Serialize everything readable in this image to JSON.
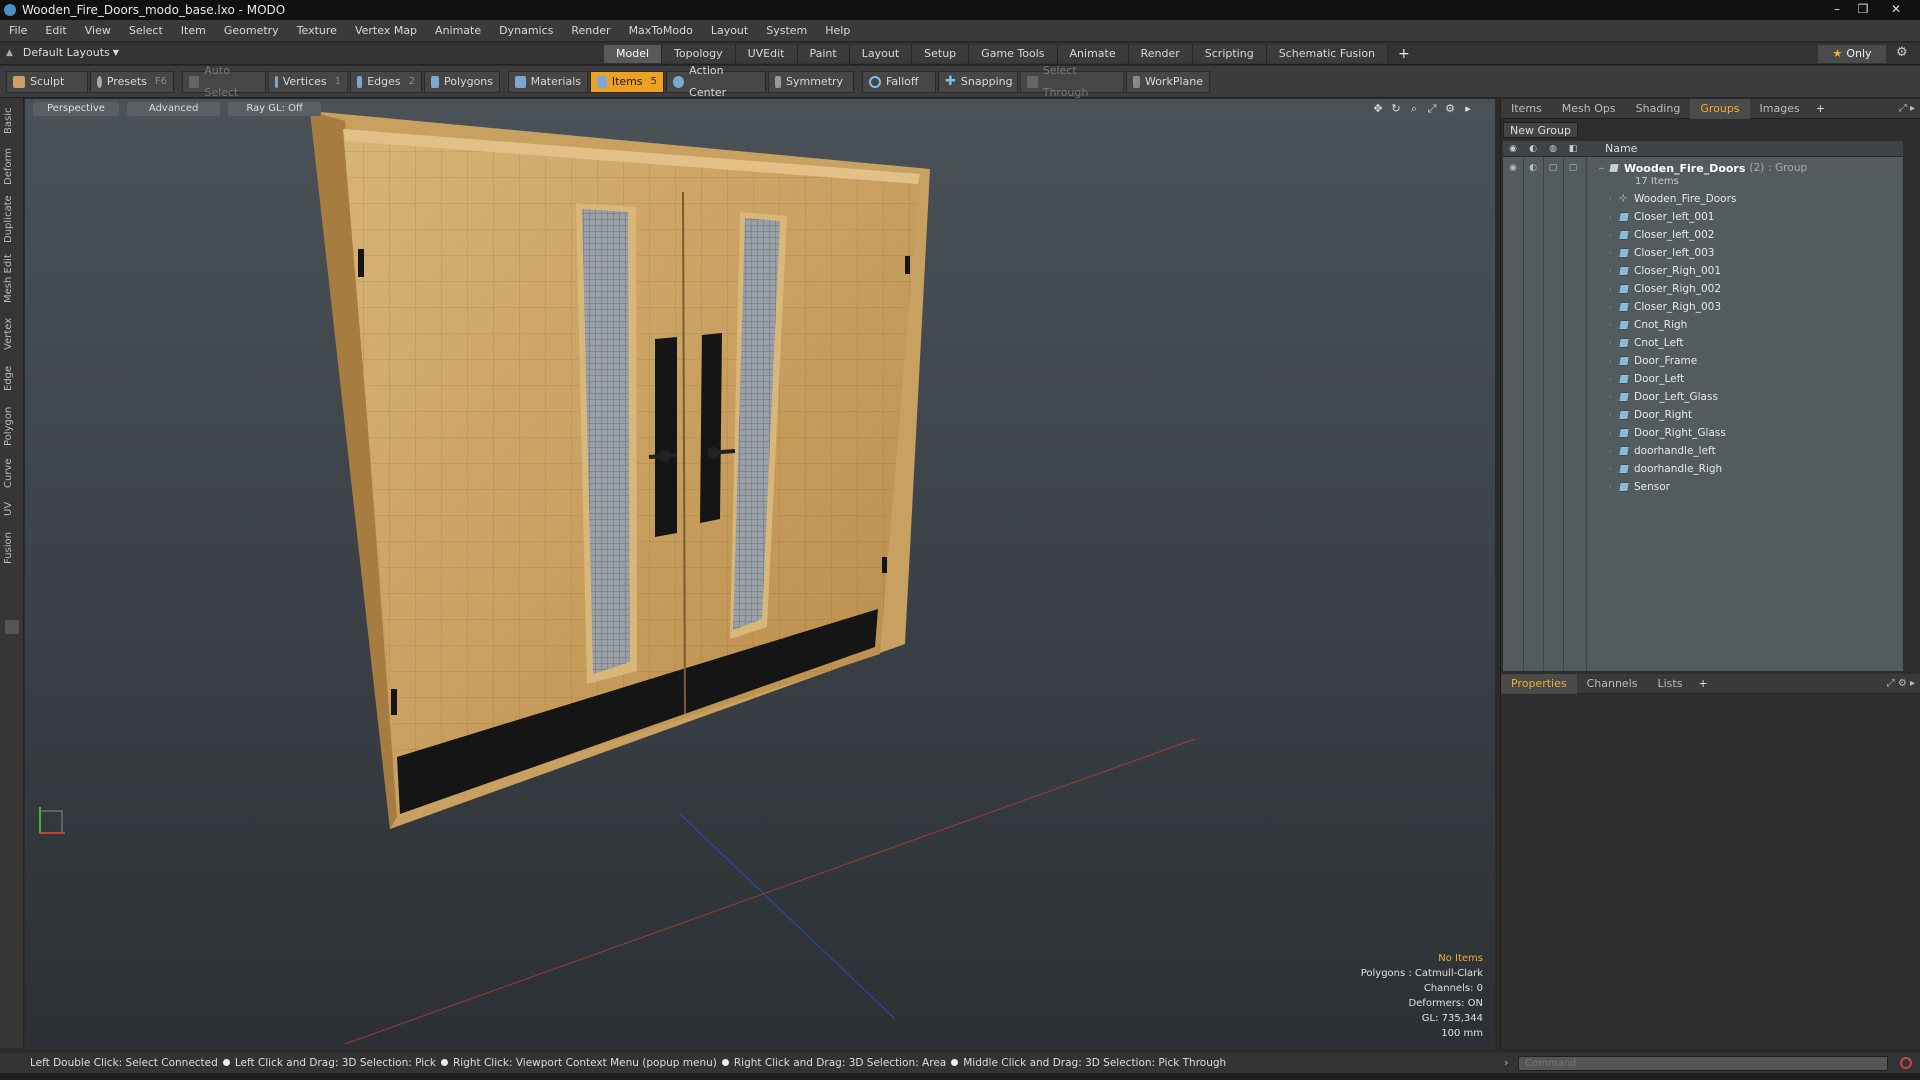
{
  "window": {
    "title": "Wooden_Fire_Doors_modo_base.lxo - MODO",
    "controls": [
      "–",
      "❐",
      "✕"
    ]
  },
  "menubar": [
    "File",
    "Edit",
    "View",
    "Select",
    "Item",
    "Geometry",
    "Texture",
    "Vertex Map",
    "Animate",
    "Dynamics",
    "Render",
    "MaxToModo",
    "Layout",
    "System",
    "Help"
  ],
  "layoutbar": {
    "layouts_label": "Default Layouts",
    "tabs": [
      "Model",
      "Topology",
      "UVEdit",
      "Paint",
      "Layout",
      "Setup",
      "Game Tools",
      "Animate",
      "Render",
      "Scripting",
      "Schematic Fusion"
    ],
    "active_tab": "Model",
    "add": "+",
    "only_label": "Only"
  },
  "toolbar": {
    "sculpt": "Sculpt",
    "presets": "Presets",
    "presets_key": "F6",
    "auto_select": "Auto Select",
    "vertices": "Vertices",
    "vertices_key": "1",
    "edges": "Edges",
    "edges_key": "2",
    "polygons": "Polygons",
    "materials": "Materials",
    "items": "Items",
    "items_key": "5",
    "action_center": "Action Center",
    "symmetry": "Symmetry",
    "falloff": "Falloff",
    "snapping": "Snapping",
    "select_through": "Select Through",
    "workplane": "WorkPlane"
  },
  "lefttabs": [
    "Basic",
    "Deform",
    "Duplicate",
    "Mesh Edit",
    "Vertex",
    "Edge",
    "Polygon",
    "Curve",
    "UV",
    "Fusion"
  ],
  "viewport": {
    "view_label": "Perspective",
    "shading_label": "Advanced",
    "raygl_label": "Ray GL: Off",
    "tools": [
      "✥",
      "↻",
      "⌕",
      "⤢",
      "⚙",
      "▸"
    ],
    "info": {
      "selection": "No Items",
      "polygons": "Polygons : Catmull-Clark",
      "channels": "Channels: 0",
      "deformers": "Deformers: ON",
      "gl": "GL: 735,344",
      "unit": "100 mm"
    }
  },
  "statusbar": [
    "Left Double Click: Select Connected",
    "Left Click and Drag: 3D Selection: Pick",
    "Right Click: Viewport Context Menu (popup menu)",
    "Right Click and Drag: 3D Selection: Area",
    "Middle Click and Drag: 3D Selection: Pick Through"
  ],
  "rightpanel": {
    "tabs": [
      "Items",
      "Mesh Ops",
      "Shading",
      "Groups",
      "Images"
    ],
    "active_tab": "Groups",
    "add": "+",
    "new_group": "New Group",
    "column_name": "Name",
    "group": {
      "name": "Wooden_Fire_Doors",
      "count": "(2)",
      "type": ": Group",
      "items_count": "17 Items"
    },
    "items": [
      {
        "name": "Wooden_Fire_Doors",
        "kind": "locator"
      },
      {
        "name": "Closer_left_001",
        "kind": "mesh"
      },
      {
        "name": "Closer_left_002",
        "kind": "mesh"
      },
      {
        "name": "Closer_left_003",
        "kind": "mesh"
      },
      {
        "name": "Closer_Righ_001",
        "kind": "mesh"
      },
      {
        "name": "Closer_Righ_002",
        "kind": "mesh"
      },
      {
        "name": "Closer_Righ_003",
        "kind": "mesh"
      },
      {
        "name": "Cnot_Righ",
        "kind": "mesh"
      },
      {
        "name": "Cnot_Left",
        "kind": "mesh"
      },
      {
        "name": "Door_Frame",
        "kind": "mesh"
      },
      {
        "name": "Door_Left",
        "kind": "mesh"
      },
      {
        "name": "Door_Left_Glass",
        "kind": "mesh"
      },
      {
        "name": "Door_Right",
        "kind": "mesh"
      },
      {
        "name": "Door_Right_Glass",
        "kind": "mesh"
      },
      {
        "name": "doorhandle_left",
        "kind": "mesh"
      },
      {
        "name": "doorhandle_Righ",
        "kind": "mesh"
      },
      {
        "name": "Sensor",
        "kind": "mesh"
      }
    ],
    "bottom_tabs": [
      "Properties",
      "Channels",
      "Lists"
    ],
    "bottom_active": "Properties"
  },
  "command": {
    "placeholder": "Command"
  },
  "colors": {
    "accent": "#f0a020",
    "active_tab_text": "#f0b030",
    "viewport_bg": "#3a4046"
  }
}
